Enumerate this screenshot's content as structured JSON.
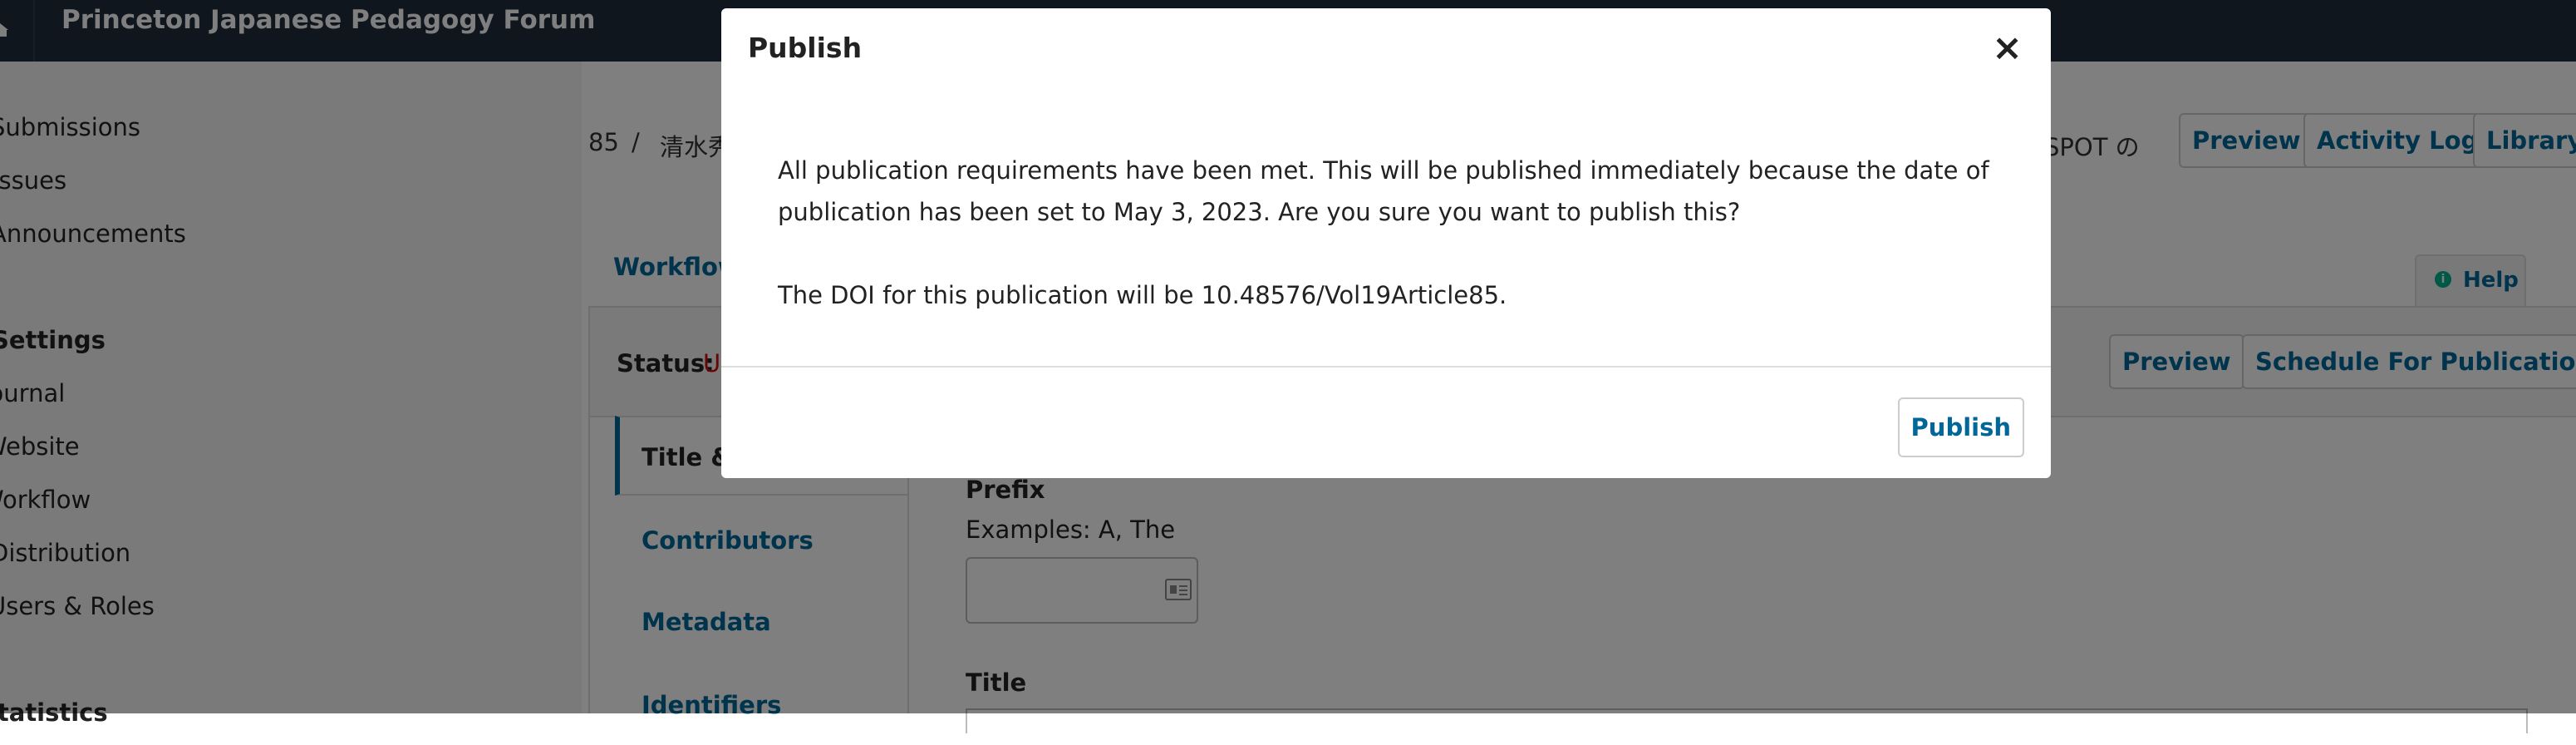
{
  "topbar": {
    "site_title": "Princeton Japanese Pedagogy Forum"
  },
  "sidebar": {
    "items": [
      {
        "label": "Submissions"
      },
      {
        "label": "Issues"
      },
      {
        "label": "Announcements"
      }
    ],
    "settings_heading": "Settings",
    "settings_items": [
      {
        "label": "Journal"
      },
      {
        "label": "Website"
      },
      {
        "label": "Workflow"
      },
      {
        "label": "Distribution"
      },
      {
        "label": "Users & Roles"
      }
    ],
    "statistics_heading": "Statistics"
  },
  "header": {
    "submission_id": "85",
    "separator": "/",
    "author_name": "清水秀",
    "title_tail": "SPOT の",
    "buttons": {
      "preview": "Preview",
      "activity_log": "Activity Log",
      "library": "Library"
    }
  },
  "tabs": {
    "workflow": "Workflow",
    "help": "Help"
  },
  "publication": {
    "status_label": "Status:",
    "status_value": "U",
    "actions": {
      "preview": "Preview",
      "schedule": "Schedule For Publication"
    },
    "vtabs": [
      {
        "label": "Title & Abstract",
        "shown": "Title &"
      },
      {
        "label": "Contributors"
      },
      {
        "label": "Metadata"
      },
      {
        "label": "Identifiers"
      }
    ],
    "form": {
      "prefix_label": "Prefix",
      "prefix_description": "Examples: A, The",
      "prefix_value": "",
      "title_label": "Title"
    }
  },
  "modal": {
    "title": "Publish",
    "close_glyph": "×",
    "message": "All publication requirements have been met. This will be published immediately because the date of publication has been set to May 3, 2023. Are you sure you want to publish this?",
    "doi_message": "The DOI for this publication will be 10.48576/Vol19Article85.",
    "publish_button": "Publish"
  },
  "colors": {
    "topbar": "#1f2d3d",
    "accent": "#006798",
    "status": "#d00a0a",
    "help_icon": "#00b28f"
  },
  "icons": {
    "help": "info-icon",
    "prefix_input": "id-card-icon",
    "close": "close-icon",
    "home": "home-icon"
  }
}
